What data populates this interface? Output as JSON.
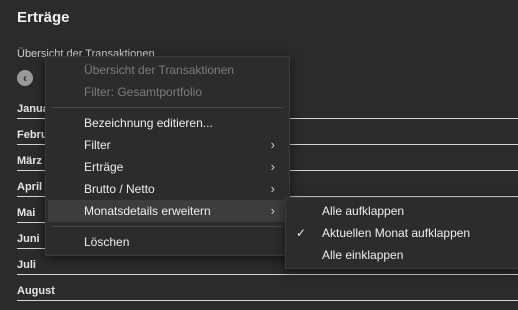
{
  "page": {
    "title": "Erträge",
    "subtitle": "Übersicht der Transaktionen",
    "back_icon": "chevron-left-circle-icon"
  },
  "months": [
    "Januar",
    "Februar",
    "März",
    "April",
    "Mai",
    "Juni",
    "Juli",
    "August"
  ],
  "context_menu": {
    "header_title": "Übersicht der Transaktionen",
    "header_filter": "Filter: Gesamtportfolio",
    "items": {
      "edit_name": "Bezeichnung editieren...",
      "filter": "Filter",
      "ertraege": "Erträge",
      "brutto_netto": "Brutto / Netto",
      "month_details": "Monatsdetails erweitern",
      "delete": "Löschen"
    },
    "submenu_arrow": "›"
  },
  "submenu": {
    "expand_all": "Alle aufklappen",
    "expand_current": "Aktuellen Monat aufklappen",
    "collapse_all": "Alle einklappen",
    "checked": "expand_current",
    "check_glyph": "✓"
  }
}
